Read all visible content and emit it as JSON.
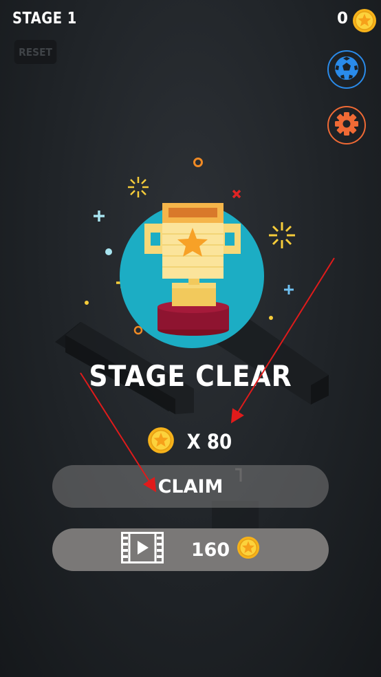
{
  "hud": {
    "stage_label": "STAGE 1",
    "coin_total": "0",
    "reset_label": "RESET"
  },
  "result": {
    "headline": "STAGE CLEAR",
    "reward_text": "X 80"
  },
  "buttons": {
    "claim_label": "CLAIM",
    "ad_reward_amount": "160"
  },
  "icons": {
    "coin": "coin-star-icon",
    "ball": "soccer-ball-icon",
    "settings": "gear-icon",
    "ad": "video-play-icon",
    "trophy": "trophy-illustration"
  },
  "colors": {
    "coin_gold": "#f6b21a",
    "ball_blue": "#2a8bea",
    "gear_orange": "#f06a35",
    "trophy_backdrop": "#1cadc4",
    "annotation_arrow": "#e01b1b"
  }
}
